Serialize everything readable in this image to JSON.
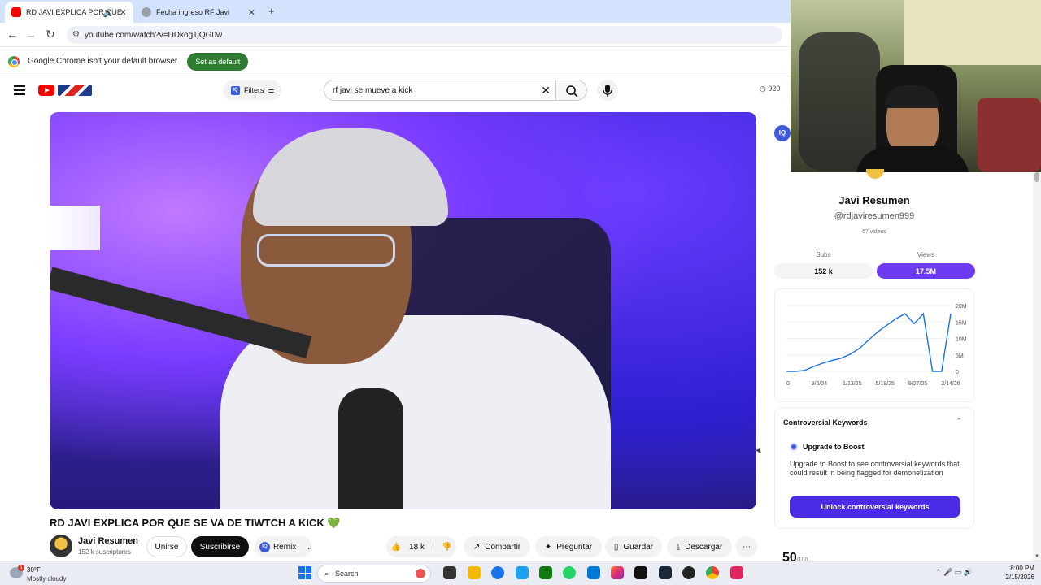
{
  "browser": {
    "tabs": [
      {
        "label": "RD JAVI EXPLICA POR QUE",
        "favicon": "youtube-icon"
      },
      {
        "label": "Fecha ingreso RF Javi",
        "favicon": "globe-icon"
      }
    ],
    "new_tab": "+",
    "url": "youtube.com/watch?v=DDkog1jQG0w",
    "infobar": {
      "text": "Google Chrome isn't your default browser",
      "button": "Set as default"
    }
  },
  "youtube": {
    "filters_label": "Filters",
    "search_value": "rf javi se mueve a kick",
    "header_views": "920"
  },
  "video": {
    "title": "RD JAVI EXPLICA POR QUE SE VA DE TIWTCH A KICK",
    "title_emoji": "💚",
    "channel": "Javi Resumen",
    "subscribers": "152 k suscriptores",
    "join_label": "Unirse",
    "subscribe_label": "Suscribirse",
    "remix_label": "Remix",
    "likes": "18 k",
    "share_label": "Compartir",
    "ask_label": "Preguntar",
    "save_label": "Guardar",
    "download_label": "Descargar"
  },
  "side_panel": {
    "logo": "IQ",
    "channel_name": "Javi Resumen",
    "handle": "@rdjaviresumen999",
    "videos": "67 videos",
    "subs_label": "Subs",
    "subs_value": "152 k",
    "views_label": "Views",
    "views_value": "17.5M",
    "keywords_title": "Controversial Keywords",
    "upgrade_label": "Upgrade to Boost",
    "upgrade_desc": "Upgrade to Boost to see controversial keywords that could result in being flagged for demonetization",
    "unlock_button": "Unlock controversial keywords",
    "score": "50",
    "score_suffix": "/100"
  },
  "chart_data": {
    "type": "line",
    "x_ticks": [
      "0",
      "9/5/24",
      "1/13/25",
      "5/19/25",
      "9/27/25",
      "2/14/26"
    ],
    "y_ticks": [
      "20M",
      "15M",
      "10M",
      "5M",
      "0"
    ],
    "ylim": [
      0,
      20000000
    ],
    "series": [
      {
        "values": [
          0,
          0,
          300000,
          1500000,
          2500000,
          3300000,
          4000000,
          5200000,
          7000000,
          9500000,
          12000000,
          14000000,
          16000000,
          17500000,
          14500000,
          17500000,
          0,
          0,
          17500000
        ]
      }
    ],
    "color": "#1a73e8"
  },
  "taskbar": {
    "temp": "30°F",
    "condition": "Mostly cloudy",
    "notif": "1",
    "search_placeholder": "Search",
    "time": "8:00 PM",
    "date": "2/15/2026"
  }
}
